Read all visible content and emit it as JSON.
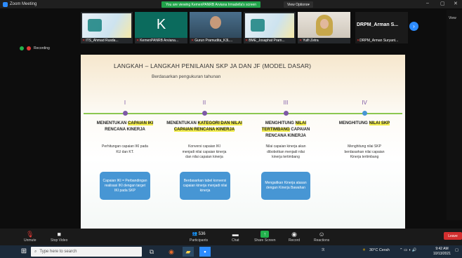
{
  "window": {
    "title": "Zoom Meeting",
    "share_banner": "You are viewing KemenPANRB Arviana Irmadella's screen",
    "view_options": "View Options",
    "controls": [
      "–",
      "▢",
      "✕"
    ]
  },
  "participants": [
    {
      "name": "ITS_Ahmad Rusda..."
    },
    {
      "name": "KemenPANRB Arviana...",
      "initial": "K"
    },
    {
      "name": "Gurun Pramudita_K3L..."
    },
    {
      "name": "BME_Josaphat Pram..."
    },
    {
      "name": "Yulfi Zetra"
    }
  ],
  "active_speaker": {
    "big_name": "DRPM_Arman S...",
    "small_name": "DRPM_Arman Suryant..."
  },
  "right_panel": {
    "view_label": "View"
  },
  "recording_label": "Recording",
  "slide": {
    "title": "LANGKAH – LANGKAH PENILAIAN SKP JA DAN JF (MODEL DASAR)",
    "subtitle": "Berdasarkan pengukuran tahunan",
    "steps": [
      {
        "roman": "I",
        "head_pre": "MENENTUKAN ",
        "head_hl": "CAPAIAN IKI",
        "head_post": " RENCANA KINERJA",
        "desc": "Perhitungan capaian IKI pada KU dan KT.",
        "box": "Capaian IKI = Perbandingan realisasi IKI dengan target IKI pada SKP",
        "dot_color": "#7d59a6"
      },
      {
        "roman": "II",
        "head_pre": "MENENTUKAN ",
        "head_hl": "KATEGORI DAN NILAI CAPAIAN RENCANA KINERJA",
        "head_post": "",
        "desc": "Konversi capaian IKI menjadi nilai capaian kinerja dan nilai capaian kinerja",
        "box": "Berdasarkan tabel konversi capaian kinerja menjadi nilai kinerja",
        "dot_color": "#7d59a6"
      },
      {
        "roman": "III",
        "head_pre": "MENGHITUNG ",
        "head_hl": "NILAI TERTIMBANG",
        "head_post": " CAPAIAN RENCANA KINERJA",
        "desc": "Nilai capaian kinerja akan dibobotkan menjadi nilai kinerja tertimbang",
        "box": "Mengaitkan Kinerja atasan dengan Kinerja Bawahan",
        "dot_color": "#7d59a6"
      },
      {
        "roman": "IV",
        "head_pre": "MENGHITUNG ",
        "head_hl": "NILAI SKP",
        "head_post": "",
        "desc": "Menghitung nilai SKP berdasarkan nilai capaian Kinerja tertimbang",
        "box": "",
        "dot_color": "#4796d4"
      }
    ]
  },
  "toolbar": {
    "unmute": "Unmute",
    "stop_video": "Stop Video",
    "participants": "Participants",
    "participants_count": "536",
    "chat": "Chat",
    "share_screen": "Share Screen",
    "record": "Record",
    "reactions": "Reactions",
    "leave": "Leave"
  },
  "taskbar": {
    "search_placeholder": "Type here to search",
    "weather": "30°C Cerah",
    "time": "9:42 AM",
    "date": "10/13/2021"
  },
  "colors": {
    "accent_green": "#22b14c",
    "timeline": "#8cc751",
    "highlight": "#f3ee4f",
    "box_blue": "#4796d4",
    "roman_purple": "#7d59a6"
  }
}
